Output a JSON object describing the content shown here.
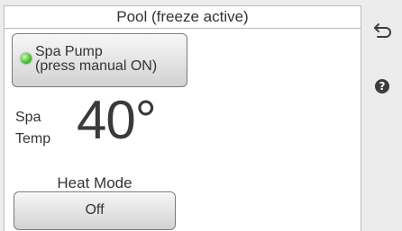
{
  "header": {
    "title": "Pool (freeze active)"
  },
  "pump": {
    "label_line1": "Spa Pump",
    "label_line2": "(press manual ON)",
    "status_color": "#4cc23a",
    "status": "on"
  },
  "temperature": {
    "label_line1": "Spa",
    "label_line2": "Temp",
    "value": "40°"
  },
  "heat_mode": {
    "title": "Heat Mode",
    "value": "Off"
  },
  "side": {
    "back_icon": "back-arrow-icon",
    "help_icon": "help-icon",
    "help_glyph": "?"
  }
}
